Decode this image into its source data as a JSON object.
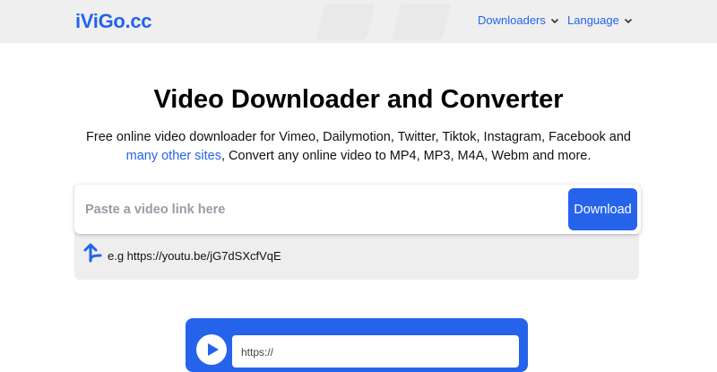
{
  "header": {
    "logo": "iViGo.cc",
    "nav": [
      {
        "label": "Downloaders"
      },
      {
        "label": "Language"
      }
    ]
  },
  "main": {
    "title": "Video Downloader and Converter",
    "subtitle_prefix": "Free online video downloader for Vimeo, Dailymotion, Twitter, Tiktok, Instagram, Facebook and ",
    "subtitle_link": "many other sites",
    "subtitle_suffix": ", Convert any online video to MP4, MP3, M4A, Webm and more."
  },
  "search": {
    "placeholder": "Paste a video link here",
    "value": "",
    "button_label": "Download",
    "example": "e.g https://youtu.be/jG7dSXcfVqE"
  },
  "preview": {
    "url_text": "https://"
  },
  "colors": {
    "accent": "#2563eb",
    "header_bg": "#efefef",
    "panel_bg": "#eeeeee"
  },
  "icons": {
    "nav_chevron": "chevron-down-icon",
    "example_arrow": "arrow-up-left-icon",
    "preview_play": "play-icon"
  }
}
